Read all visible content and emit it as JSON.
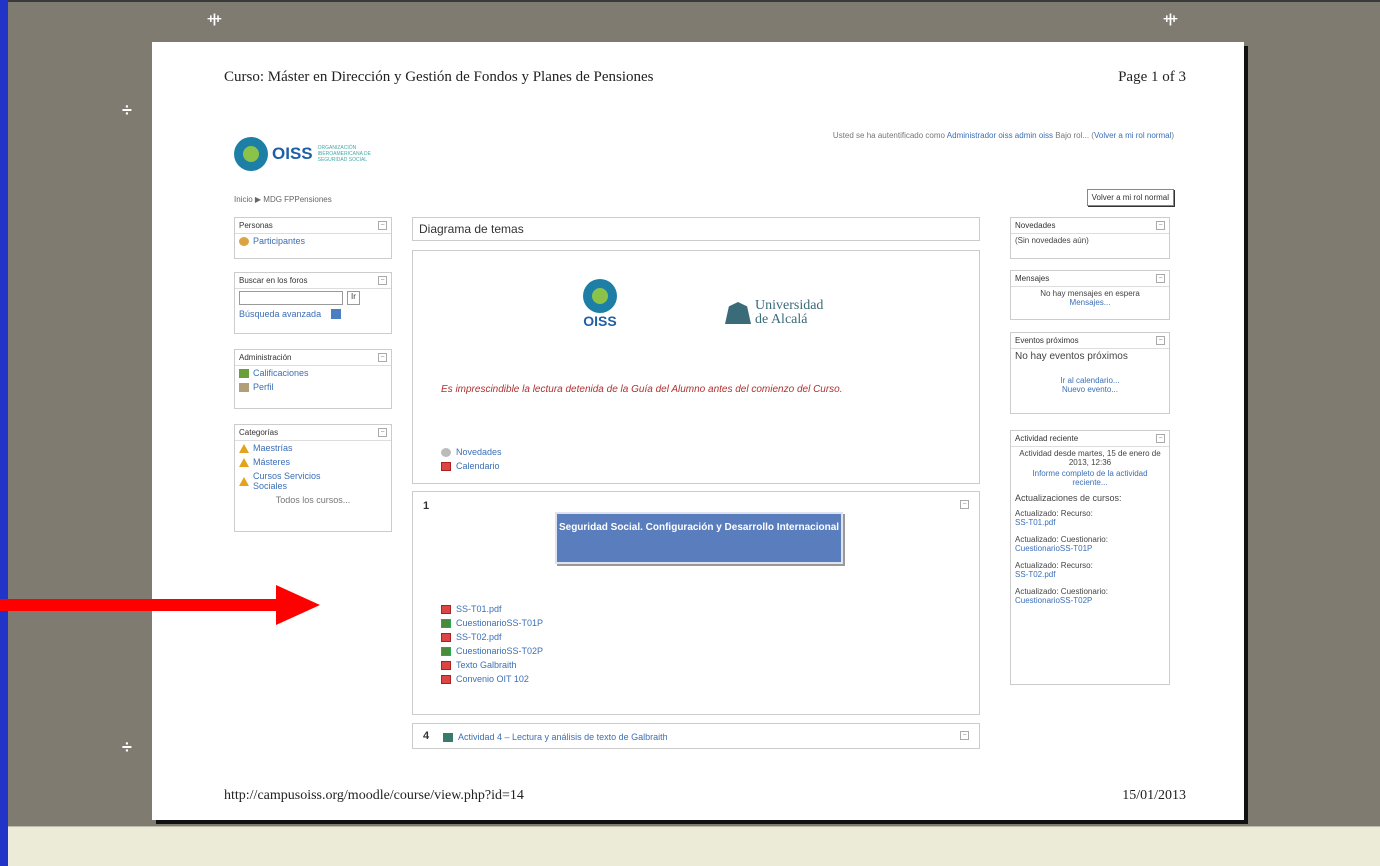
{
  "print": {
    "header_title": "Curso: Máster en Dirección y Gestión de Fondos y Planes de Pensiones",
    "page_label": "Page 1 of 3",
    "footer_url": "http://campusoiss.org/moodle/course/view.php?id=14",
    "footer_date": "15/01/2013"
  },
  "site": {
    "logo_text": "OISS",
    "logo_subtitle": "ORGANIZACIÓN IBEROAMERICANA DE SEGURIDAD SOCIAL",
    "login_prefix": "Usted se ha autentificado como",
    "login_user": "Administrador oiss admin oiss",
    "login_switch": "Bajo rol...",
    "login_return": "Volver a mi rol normal",
    "breadcrumb": "Inicio ▶ MDG FPPensiones",
    "return_button": "Volver a mi rol normal"
  },
  "left_blocks": {
    "personas": {
      "title": "Personas",
      "items": [
        "Participantes"
      ]
    },
    "buscar": {
      "title": "Buscar en los foros",
      "button": "Ir",
      "advanced": "Búsqueda avanzada"
    },
    "admin": {
      "title": "Administración",
      "items": [
        "Calificaciones",
        "Perfil"
      ]
    },
    "categorias": {
      "title": "Categorías",
      "items": [
        "Maestrías",
        "Másteres",
        "Cursos Servicios Sociales"
      ],
      "all": "Todos los cursos..."
    }
  },
  "center": {
    "section_title": "Diagrama de temas",
    "uni_name_1": "Universidad",
    "uni_name_2": "de Alcalá",
    "intro_note": "Es imprescindible la lectura detenida de la Guía del Alumno antes del comienzo del Curso.",
    "intro_links": [
      "Novedades",
      "Calendario"
    ],
    "topic1_num": "1",
    "topic1_banner": "Seguridad Social. Configuración y Desarrollo Internacional",
    "topic1_links": [
      {
        "icon": "pdf",
        "label": "SS-T01.pdf"
      },
      {
        "icon": "quiz",
        "label": "CuestionarioSS-T01P"
      },
      {
        "icon": "pdf",
        "label": "SS-T02.pdf"
      },
      {
        "icon": "quiz",
        "label": "CuestionarioSS-T02P"
      },
      {
        "icon": "pdf",
        "label": "Texto Galbraith"
      },
      {
        "icon": "pdf",
        "label": "Convenio OIT 102"
      }
    ],
    "topic4_num": "4",
    "topic4_link": "Actividad 4 – Lectura y análisis de texto de Galbraith"
  },
  "right_blocks": {
    "novedades": {
      "title": "Novedades",
      "text": "(Sin novedades aún)"
    },
    "mensajes": {
      "title": "Mensajes",
      "text": "No hay mensajes en espera",
      "link": "Mensajes..."
    },
    "eventos": {
      "title": "Eventos próximos",
      "text": "No hay eventos próximos",
      "link1": "Ir al calendario...",
      "link2": "Nuevo evento..."
    },
    "actividad": {
      "title": "Actividad reciente",
      "since": "Actividad desde martes, 15 de enero de 2013, 12:36",
      "report": "Informe completo de la actividad reciente...",
      "updates_heading": "Actualizaciones de cursos:",
      "updates": [
        {
          "label": "Actualizado: Recurso:",
          "link": "SS-T01.pdf"
        },
        {
          "label": "Actualizado: Cuestionario:",
          "link": "CuestionarioSS-T01P"
        },
        {
          "label": "Actualizado: Recurso:",
          "link": "SS-T02.pdf"
        },
        {
          "label": "Actualizado: Cuestionario:",
          "link": "CuestionarioSS-T02P"
        }
      ]
    }
  },
  "colors": {
    "arrow": "#ff0000",
    "banner": "#5a7dbd",
    "link": "#3b6fb7",
    "note": "#b03030"
  }
}
